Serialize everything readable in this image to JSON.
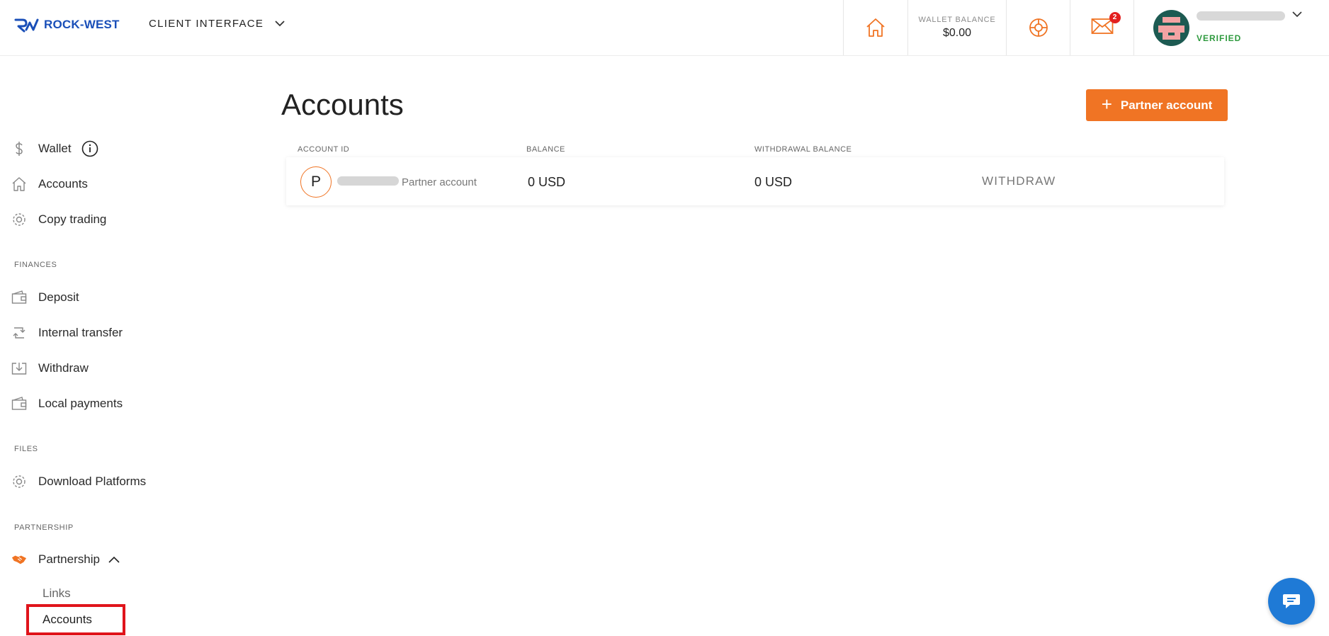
{
  "header": {
    "logo_text": "ROCK-WEST",
    "client_interface_label": "CLIENT INTERFACE",
    "wallet_balance_label": "WALLET BALANCE",
    "wallet_balance_value": "$0.00",
    "mail_badge_count": "2",
    "verified_label": "VERIFIED"
  },
  "sidebar": {
    "items": [
      {
        "label": "Wallet",
        "icon": "dollar-icon"
      },
      {
        "label": "Accounts",
        "icon": "home-icon"
      },
      {
        "label": "Copy trading",
        "icon": "gear-icon"
      }
    ],
    "finances_title": "FINANCES",
    "finances": [
      {
        "label": "Deposit",
        "icon": "wallet-icon"
      },
      {
        "label": "Internal transfer",
        "icon": "transfer-icon"
      },
      {
        "label": "Withdraw",
        "icon": "withdraw-icon"
      },
      {
        "label": "Local payments",
        "icon": "wallet-icon"
      }
    ],
    "files_title": "FILES",
    "files": [
      {
        "label": "Download Platforms",
        "icon": "gear-icon"
      }
    ],
    "partnership_title": "PARTNERSHIP",
    "partnership": {
      "label": "Partnership",
      "icon": "handshake-icon"
    },
    "partnership_sub": [
      {
        "label": "Links"
      },
      {
        "label": "Accounts"
      }
    ]
  },
  "main": {
    "title": "Accounts",
    "partner_button": "Partner account",
    "columns": [
      "ACCOUNT ID",
      "BALANCE",
      "WITHDRAWAL BALANCE"
    ],
    "rows": [
      {
        "initial": "P",
        "account_type": "Partner account",
        "balance": "0 USD",
        "withdrawal_balance": "0 USD",
        "action": "WITHDRAW"
      }
    ]
  },
  "colors": {
    "accent": "#f07424",
    "brand_blue": "#1a4fb8",
    "verified_green": "#2e9a3e",
    "highlight_red": "#e0141b",
    "chat_blue": "#1f7ad6"
  }
}
